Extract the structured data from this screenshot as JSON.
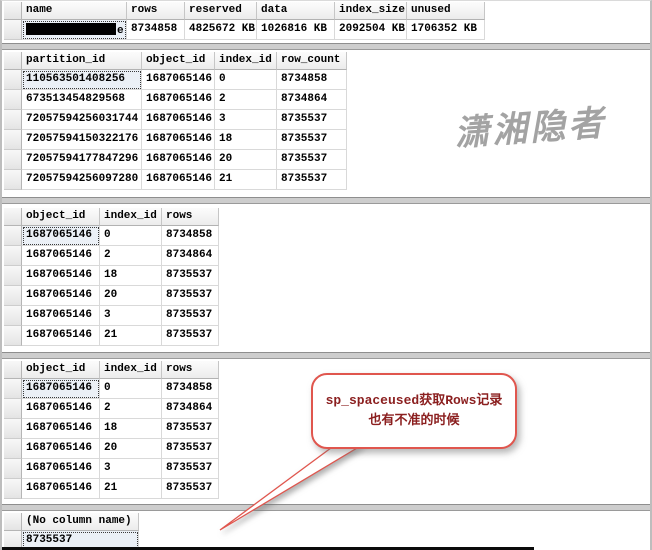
{
  "watermark": {
    "text": "潇湘隐者"
  },
  "callout": {
    "line1": "sp_spaceused获取Rows记录",
    "line2": "也有不准的时候"
  },
  "colors": {
    "callout_border_red": "#e0564e",
    "callout_text_red": "#8b1f1f",
    "watermark_gray": "#9c9c9c",
    "selected_cell_bg": "#ebf0f6",
    "redaction_black": "#000000"
  },
  "grids": [
    {
      "id": "spaceused-summary",
      "columns": [
        "name",
        "rows",
        "reserved",
        "data",
        "index_size",
        "unused"
      ],
      "rows": [
        [
          {
            "redacted": true,
            "visible_text": "e"
          },
          "8734858",
          "4825672 KB",
          "1026816 KB",
          "2092504 KB",
          "1706352 KB"
        ]
      ],
      "selected_cell": {
        "row": 0,
        "col": 0
      }
    },
    {
      "id": "partition-stats",
      "columns": [
        "partition_id",
        "object_id",
        "index_id",
        "row_count"
      ],
      "rows": [
        [
          "110563501408256",
          "1687065146",
          "0",
          "8734858"
        ],
        [
          "673513454829568",
          "1687065146",
          "2",
          "8734864"
        ],
        [
          "72057594256031744",
          "1687065146",
          "3",
          "8735537"
        ],
        [
          "72057594150322176",
          "1687065146",
          "18",
          "8735537"
        ],
        [
          "72057594177847296",
          "1687065146",
          "20",
          "8735537"
        ],
        [
          "72057594256097280",
          "1687065146",
          "21",
          "8735537"
        ]
      ],
      "selected_cell": {
        "row": 0,
        "col": 0
      }
    },
    {
      "id": "index-rows-a",
      "columns": [
        "object_id",
        "index_id",
        "rows"
      ],
      "rows": [
        [
          "1687065146",
          "0",
          "8734858"
        ],
        [
          "1687065146",
          "2",
          "8734864"
        ],
        [
          "1687065146",
          "18",
          "8735537"
        ],
        [
          "1687065146",
          "20",
          "8735537"
        ],
        [
          "1687065146",
          "3",
          "8735537"
        ],
        [
          "1687065146",
          "21",
          "8735537"
        ]
      ],
      "selected_cell": {
        "row": 0,
        "col": 0
      }
    },
    {
      "id": "index-rows-b",
      "columns": [
        "object_id",
        "index_id",
        "rows"
      ],
      "rows": [
        [
          "1687065146",
          "0",
          "8734858"
        ],
        [
          "1687065146",
          "2",
          "8734864"
        ],
        [
          "1687065146",
          "18",
          "8735537"
        ],
        [
          "1687065146",
          "20",
          "8735537"
        ],
        [
          "1687065146",
          "3",
          "8735537"
        ],
        [
          "1687065146",
          "21",
          "8735537"
        ]
      ],
      "selected_cell": {
        "row": 0,
        "col": 0
      }
    },
    {
      "id": "scalar-count",
      "columns": [
        "(No column name)"
      ],
      "rows": [
        [
          "8735537"
        ]
      ],
      "selected_cell": {
        "row": 0,
        "col": 0
      }
    }
  ]
}
